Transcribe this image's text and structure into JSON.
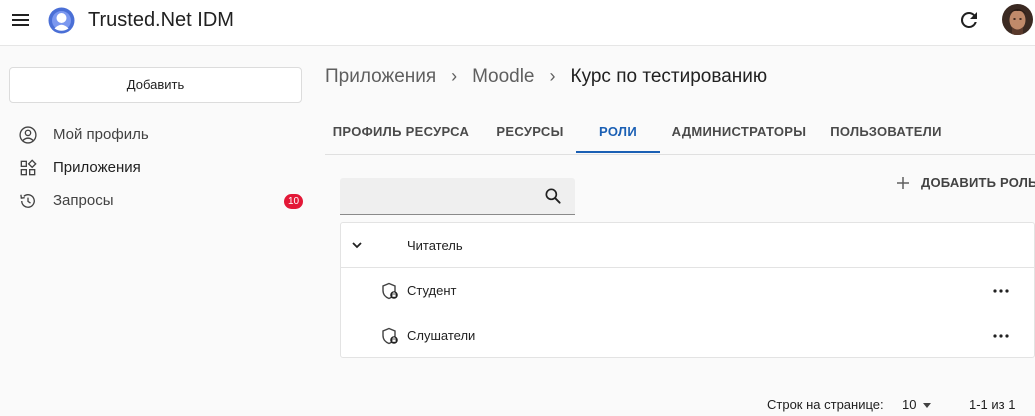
{
  "header": {
    "app_title": "Trusted.Net IDM",
    "menu_icon": "hamburger-menu-icon",
    "logo_icon": "trusted-net-logo-icon",
    "refresh_icon": "refresh-icon",
    "avatar": "user-avatar"
  },
  "sidebar": {
    "add_button": "Добавить",
    "items": [
      {
        "label": "Мой профиль",
        "icon": "account-circle-icon",
        "active": false
      },
      {
        "label": "Приложения",
        "icon": "apps-grid-icon",
        "active": true
      },
      {
        "label": "Запросы",
        "icon": "history-icon",
        "badge": "10",
        "active": false
      }
    ]
  },
  "breadcrumbs": [
    "Приложения",
    "Moodle",
    "Курс по тестированию"
  ],
  "tabs": [
    {
      "label": "ПРОФИЛЬ РЕСУРСА",
      "active": false
    },
    {
      "label": "РЕСУРСЫ",
      "active": false
    },
    {
      "label": "РОЛИ",
      "active": true
    },
    {
      "label": "АДМИНИСТРАТОРЫ",
      "active": false
    },
    {
      "label": "ПОЛЬЗОВАТЕЛИ",
      "active": false
    }
  ],
  "search": {
    "value": "",
    "placeholder": ""
  },
  "add_role": {
    "label": "ДОБАВИТЬ РОЛЬ",
    "icon": "plus-icon"
  },
  "roles": {
    "group": {
      "label": "Читатель",
      "expanded": true
    },
    "children": [
      {
        "label": "Студент",
        "icon": "shield-lock-icon"
      },
      {
        "label": "Слушатели",
        "icon": "shield-lock-icon"
      }
    ]
  },
  "pagination": {
    "rows_label": "Строк на странице:",
    "rows_per_page": "10",
    "range": "1-1 из 1"
  },
  "colors": {
    "accent": "#1a5fb4",
    "badge": "#e31837",
    "background": "#fafafa"
  }
}
